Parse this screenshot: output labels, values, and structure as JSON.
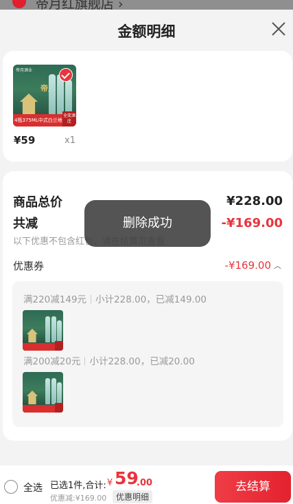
{
  "header_strip": {
    "store_name": "帝月红旗舰店 ›"
  },
  "sheet": {
    "title": "金额明细"
  },
  "product": {
    "image_text": "4瓶375ML中式白兰地",
    "image_corner": "全奖\n酒庄",
    "price": "¥59",
    "qty": "x1"
  },
  "summary": {
    "goods_total_label": "商品总价",
    "goods_total_value": "¥228.00",
    "total_reduction_label": "共减",
    "total_reduction_value": "-¥169.00",
    "note": "以下优惠不包含红包，请在结算页查看",
    "coupon_label": "优惠券",
    "coupon_value": "-¥169.00"
  },
  "rules": [
    {
      "rule": "满220减149元",
      "detail": "小计228.00，已减149.00"
    },
    {
      "rule": "满200减20元",
      "detail": "小计228.00，已减20.00"
    }
  ],
  "toast": {
    "text": "删除成功"
  },
  "footer": {
    "select_all": "全选",
    "selected_summary": "已选1件,合计:",
    "currency": "¥",
    "total_integer": "59",
    "total_decimal": ".00",
    "discount_text": "优惠减:¥169.00",
    "detail_link": "优惠明细",
    "checkout": "去结算"
  },
  "colors": {
    "accent_red": "#e8343d",
    "toast_bg": "#3c3c3c"
  }
}
